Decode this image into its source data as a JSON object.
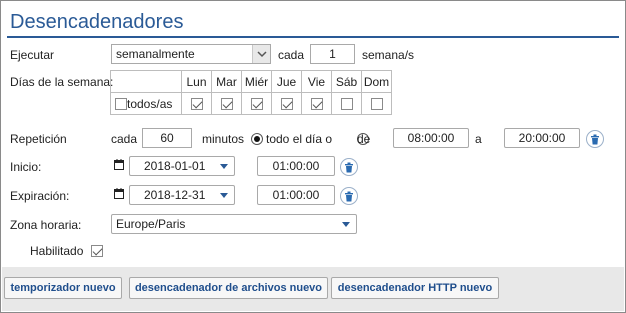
{
  "header": {
    "title": "Desencadenadores"
  },
  "ejecutar": {
    "label": "Ejecutar",
    "value": "semanalmente",
    "cada": "cada",
    "count": "1",
    "unit": "semana/s"
  },
  "days": {
    "label": "Días de la semana:",
    "all_label": "todos/as",
    "names": [
      "Lun",
      "Mar",
      "Miér",
      "Jue",
      "Vie",
      "Sáb",
      "Dom"
    ],
    "checked": [
      true,
      true,
      true,
      true,
      true,
      false,
      false
    ]
  },
  "repeticion": {
    "label": "Repetición",
    "cada": "cada",
    "value": "60",
    "unit": "minutos",
    "all_day": "todo el día o",
    "from": "de",
    "start": "08:00:00",
    "to": "a",
    "end": "20:00:00"
  },
  "inicio": {
    "label": "Inicio:",
    "date": "2018-01-01",
    "time": "01:00:00"
  },
  "expiracion": {
    "label": "Expiración:",
    "date": "2018-12-31",
    "time": "01:00:00"
  },
  "zona": {
    "label": "Zona horaria:",
    "value": "Europe/Paris"
  },
  "habilitado": {
    "label": "Habilitado",
    "checked": true
  },
  "buttons": {
    "new_timer": "temporizador nuevo",
    "new_file": "desencadenador de archivos nuevo",
    "new_http": "desencadenador HTTP nuevo"
  }
}
